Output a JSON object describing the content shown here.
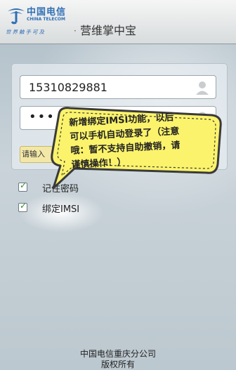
{
  "header": {
    "logo_cn": "中国电信",
    "logo_en": "CHINA TELECOM",
    "logo_slogan": "世界触手可及",
    "separator": "·",
    "app_title": "营维掌中宝"
  },
  "login": {
    "username_value": "15310829881",
    "password_value": "•••",
    "hint_text": "请输入",
    "remember_label": "记住密码",
    "bind_imsi_label": "绑定IMSI",
    "remember_checked": true,
    "bind_imsi_checked": true
  },
  "tooltip": {
    "line1": "新增绑定IMSI功能，以后",
    "line2": "可以手机自动登录了（注意",
    "line3": "哦：暂不支持自助撤销，请",
    "line4": "谨慎操作！）",
    "bubble_color": "#fbf36b"
  },
  "footer": {
    "line1": "中国电信重庆分公司",
    "line2": "版权所有"
  },
  "icons": {
    "user": "user-icon",
    "lock": "lock-icon",
    "check": "check-icon"
  }
}
